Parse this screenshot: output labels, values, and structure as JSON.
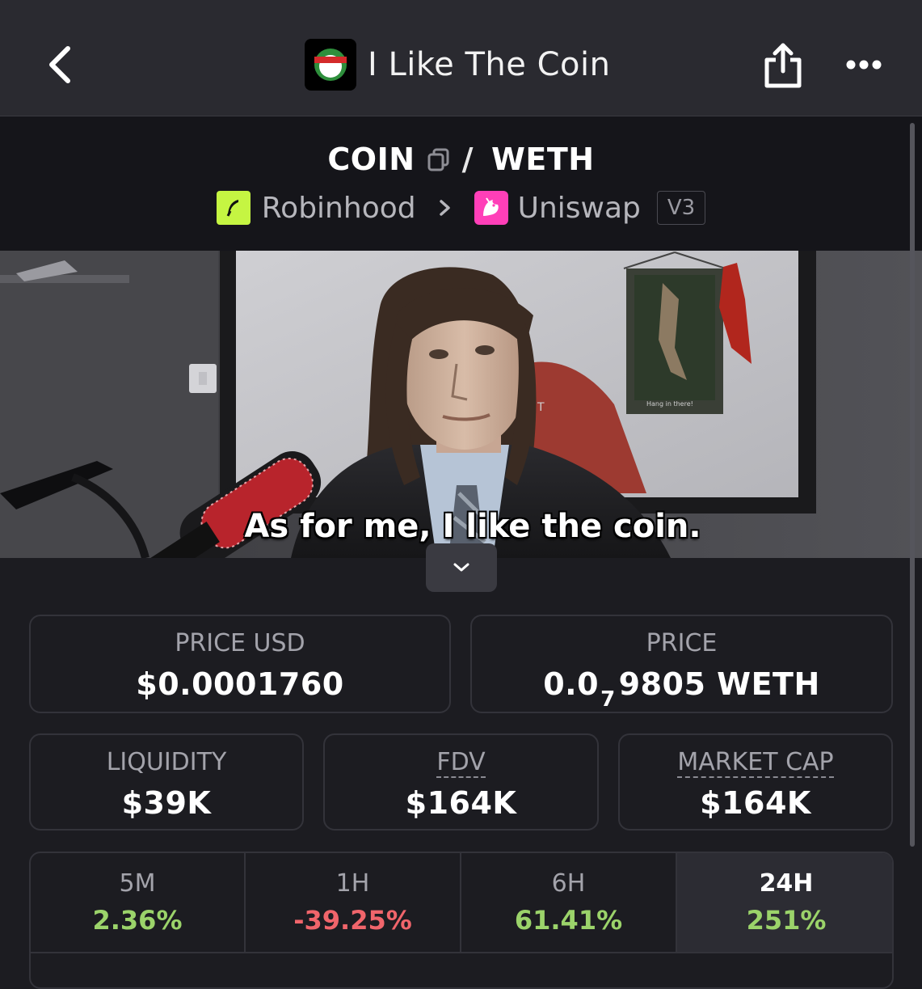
{
  "header": {
    "title": "I Like The Coin"
  },
  "pair": {
    "base": "COIN",
    "separator": "/",
    "quote": "WETH",
    "chain": "Robinhood",
    "dex": "Uniswap",
    "version": "V3"
  },
  "media": {
    "caption": "As for me, I like the coin.",
    "poster_text": "Hang in there!"
  },
  "stats": {
    "price_usd": {
      "label": "PRICE USD",
      "value": "$0.0001760"
    },
    "price": {
      "label": "PRICE",
      "value_prefix": "0.0",
      "value_subscript": "7",
      "value_suffix": "9805 WETH"
    },
    "liquidity": {
      "label": "LIQUIDITY",
      "value": "$39K"
    },
    "fdv": {
      "label": "FDV",
      "value": "$164K"
    },
    "market_cap": {
      "label": "MARKET CAP",
      "value": "$164K"
    }
  },
  "changes": [
    {
      "label": "5M",
      "value": "2.36%",
      "direction": "up"
    },
    {
      "label": "1H",
      "value": "-39.25%",
      "direction": "down"
    },
    {
      "label": "6H",
      "value": "61.41%",
      "direction": "up"
    },
    {
      "label": "24H",
      "value": "251%",
      "direction": "up",
      "selected": true
    }
  ],
  "colors": {
    "background": "#1c1c21",
    "topbar": "#2a2a30",
    "positive": "#9bd36a",
    "negative": "#f0656b",
    "robinhood": "#c5f542",
    "uniswap": "#ff3fb8"
  }
}
